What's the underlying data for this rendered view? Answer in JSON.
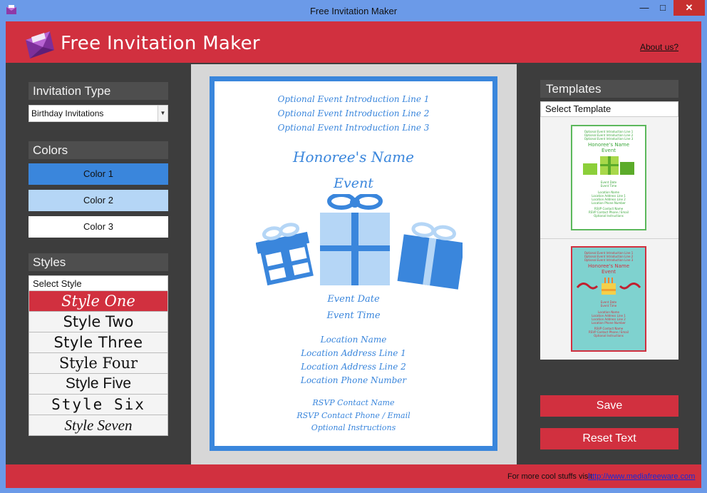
{
  "window": {
    "title": "Free Invitation Maker",
    "minimize": "—",
    "maximize": "□",
    "close": "✕"
  },
  "header": {
    "title": "Free Invitation Maker",
    "about_link": "About us?"
  },
  "invitation_type": {
    "heading": "Invitation Type",
    "selected": "Birthday Invitations"
  },
  "colors": {
    "heading": "Colors",
    "items": [
      {
        "label": "Color 1",
        "value": "#3a86dc"
      },
      {
        "label": "Color 2",
        "value": "#b5d6f6"
      },
      {
        "label": "Color 3",
        "value": "#ffffff"
      }
    ]
  },
  "styles": {
    "heading": "Styles",
    "select_label": "Select Style",
    "items": [
      "Style One",
      "Style Two",
      "Style Three",
      "Style Four",
      "Style Five",
      "Style Six",
      "Style Seven"
    ],
    "active_index": 0
  },
  "card": {
    "intro1": "Optional Event Introduction Line 1",
    "intro2": "Optional Event Introduction Line 2",
    "intro3": "Optional Event Introduction Line 3",
    "honoree": "Honoree's Name",
    "event": "Event",
    "date": "Event Date",
    "time": "Event Time",
    "location": "Location Name",
    "address1": "Location Address Line 1",
    "address2": "Location Address Line 2",
    "phone": "Location Phone Number",
    "rsvp_name": "RSVP Contact Name",
    "rsvp_phone": "RSVP Contact Phone / Email",
    "instructions": "Optional Instructions"
  },
  "templates": {
    "heading": "Templates",
    "select_label": "Select Template",
    "green": {
      "intro1": "Optional Event Introduction Line 1",
      "intro2": "Optional Event Introduction Line 2",
      "intro3": "Optional Event Introduction Line 3",
      "honoree": "Honoree's Name",
      "event": "Event",
      "date": "Event Date",
      "time": "Event Time",
      "location": "Location Name",
      "address1": "Location Address Line 1",
      "address2": "Location Address Line 2",
      "phone": "Location Phone Number",
      "rsvp_name": "RSVP Contact Name",
      "rsvp_phone": "RSVP Contact Phone / Email",
      "instructions": "Optional Instructions"
    },
    "red": {
      "intro1": "Optional Event Introduction Line 1",
      "intro2": "Optional Event Introduction Line 2",
      "intro3": "Optional Event Introduction Line 3",
      "honoree": "Honoree's Name",
      "event": "Event",
      "date": "Event Date",
      "time": "Event Time",
      "location": "Location Name",
      "address1": "Location Address Line 1",
      "address2": "Location Address Line 2",
      "phone": "Location Phone Number",
      "rsvp_name": "RSVP Contact Name",
      "rsvp_phone": "RSVP Contact Phone / Email",
      "instructions": "Optional Instructions"
    }
  },
  "actions": {
    "save": "Save",
    "reset": "Reset Text"
  },
  "footer": {
    "text": "For more cool stuffs visit:",
    "link": "http://www.mediafreeware.com"
  }
}
